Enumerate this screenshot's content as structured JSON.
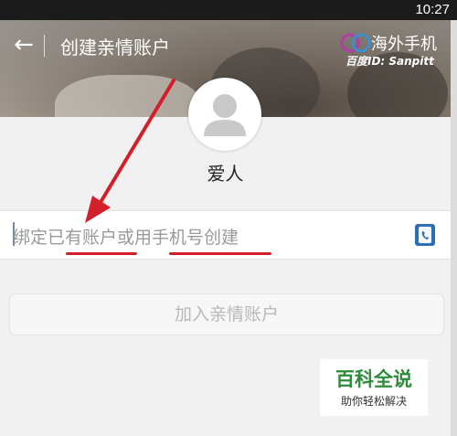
{
  "status_bar": {
    "time": "10:27"
  },
  "header": {
    "back_icon": "arrow-left-icon",
    "title": "创建亲情账户",
    "watermark_text": "海外手机",
    "watermark_sub": "百度ID: Sanpitt"
  },
  "profile": {
    "avatar_icon": "person-placeholder-icon",
    "name": "爱人"
  },
  "input": {
    "text": "绑定已有账户或用手机号创建",
    "contact_icon": "contact-book-icon"
  },
  "join_button": {
    "label": "加入亲情账户",
    "disabled": true
  },
  "baike_badge": {
    "title": "百科全说",
    "subtitle": "助你轻松解决"
  },
  "colors": {
    "annotation_red": "#d21f2a",
    "baike_green": "#2e8b3a",
    "contact_blue": "#2d6fb7"
  }
}
